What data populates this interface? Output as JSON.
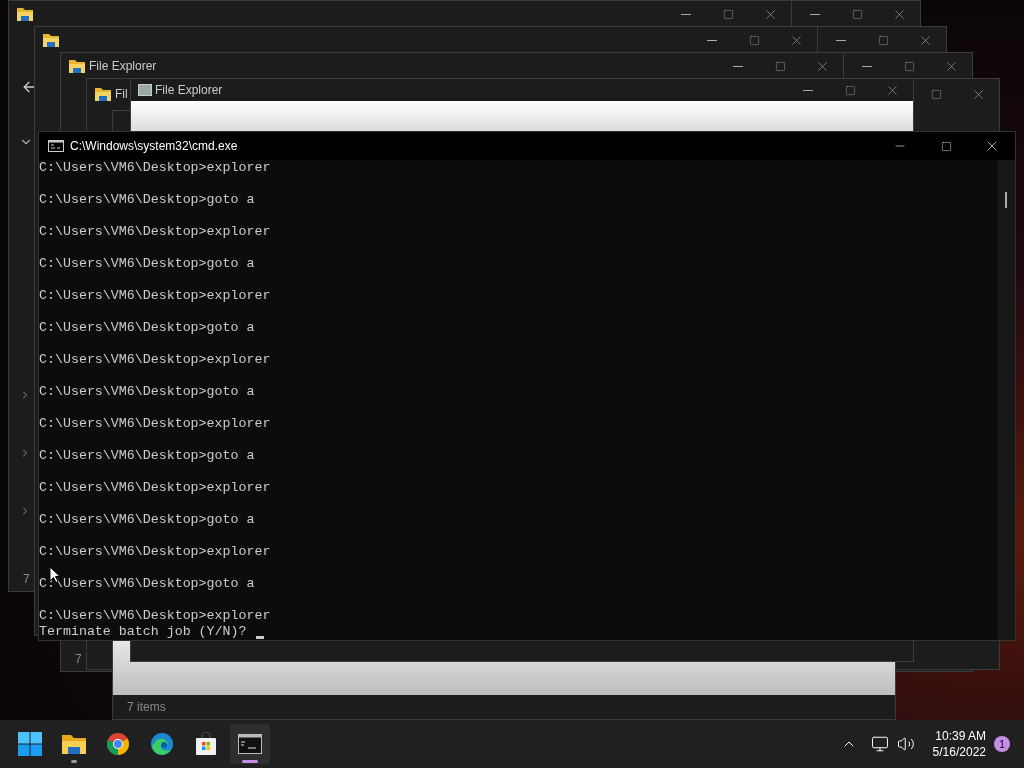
{
  "explorer_windows": [
    {
      "title": "File Explorer"
    },
    {
      "title": "Fil"
    },
    {
      "title": "File Explorer"
    }
  ],
  "status_texts": [
    "7",
    "7",
    "7 items"
  ],
  "cmd": {
    "title": "C:\\Windows\\system32\\cmd.exe",
    "lines": [
      {
        "kind": "command",
        "text": "C:\\Users\\VM6\\Desktop>explorer"
      },
      {
        "kind": "command",
        "text": "C:\\Users\\VM6\\Desktop>goto a"
      },
      {
        "kind": "command",
        "text": "C:\\Users\\VM6\\Desktop>explorer"
      },
      {
        "kind": "command",
        "text": "C:\\Users\\VM6\\Desktop>goto a"
      },
      {
        "kind": "command",
        "text": "C:\\Users\\VM6\\Desktop>explorer"
      },
      {
        "kind": "command",
        "text": "C:\\Users\\VM6\\Desktop>goto a"
      },
      {
        "kind": "command",
        "text": "C:\\Users\\VM6\\Desktop>explorer"
      },
      {
        "kind": "command",
        "text": "C:\\Users\\VM6\\Desktop>goto a"
      },
      {
        "kind": "command",
        "text": "C:\\Users\\VM6\\Desktop>explorer"
      },
      {
        "kind": "command",
        "text": "C:\\Users\\VM6\\Desktop>goto a"
      },
      {
        "kind": "command",
        "text": "C:\\Users\\VM6\\Desktop>explorer"
      },
      {
        "kind": "command",
        "text": "C:\\Users\\VM6\\Desktop>goto a"
      },
      {
        "kind": "command",
        "text": "C:\\Users\\VM6\\Desktop>explorer"
      },
      {
        "kind": "command",
        "text": "C:\\Users\\VM6\\Desktop>goto a"
      },
      {
        "kind": "command",
        "text": "C:\\Users\\VM6\\Desktop>explorer"
      },
      {
        "kind": "message",
        "text": "Terminate batch job (Y/N)? "
      }
    ]
  },
  "taskbar": {
    "apps": [
      {
        "kind": "start",
        "running": false,
        "selected": false
      },
      {
        "kind": "explorer",
        "running": true,
        "selected": false
      },
      {
        "kind": "chrome",
        "running": false,
        "selected": false
      },
      {
        "kind": "edge",
        "running": false,
        "selected": false
      },
      {
        "kind": "store",
        "running": false,
        "selected": false
      },
      {
        "kind": "terminal",
        "running": true,
        "selected": true
      }
    ],
    "time": "10:39 AM",
    "date": "5/16/2022",
    "notification_count": "1"
  }
}
